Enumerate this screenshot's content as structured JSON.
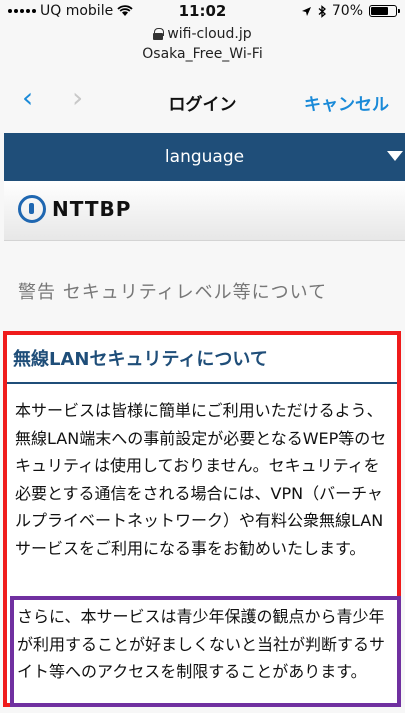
{
  "status_bar": {
    "carrier": "UQ mobile",
    "time": "11:02",
    "battery": "70%",
    "battery_level": 0.7,
    "icons": [
      "signal-icon",
      "wifi-icon",
      "location-icon",
      "bluetooth-icon",
      "battery-icon"
    ]
  },
  "address": {
    "url": "wifi-cloud.jp",
    "site_title": "Osaka_Free_Wi-Fi"
  },
  "nav": {
    "back": "‹",
    "forward": "›",
    "title": "ログイン",
    "cancel": "キャンセル"
  },
  "language_bar": {
    "label": "language"
  },
  "logo": {
    "text": "NTTBP"
  },
  "warning": {
    "heading": "警告 セキュリティレベル等について"
  },
  "security_section": {
    "title": "無線LANセキュリティについて",
    "paragraph1": "本サービスは皆様に簡単にご利用いただけるよう、無線LAN端末への事前設定が必要となるWEP等のセキュリティは使用しておりません。セキュリティを必要とする通信をされる場合には、VPN（バーチャルプライベートネットワーク）や有料公衆無線LANサービスをご利用になる事をお勧めいたします。",
    "paragraph2": "さらに、本サービスは青少年保護の観点から青少年が利用することが好ましくないと当社が判断するサイト等へのアクセスを制限することがあります。"
  },
  "colors": {
    "accent_blue": "#1a8ad8",
    "navy": "#1f4e79",
    "red_highlight": "#ef1b1b",
    "purple_highlight": "#7030a0"
  }
}
